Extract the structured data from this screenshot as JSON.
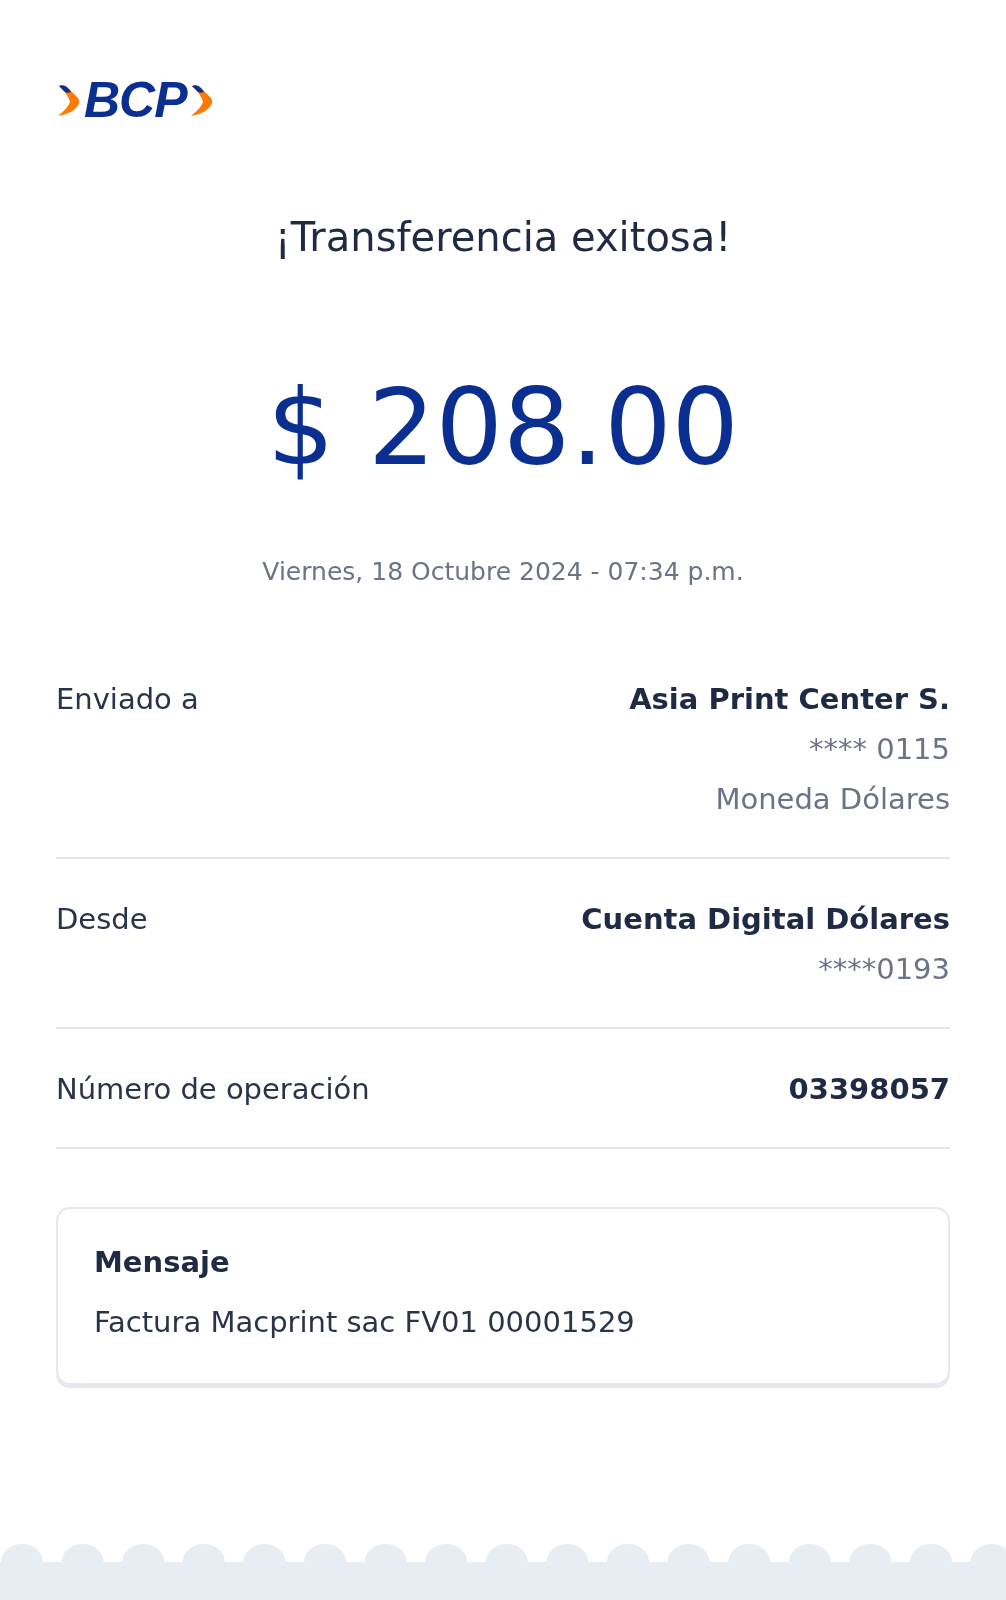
{
  "logo": {
    "text": "BCP"
  },
  "title": "¡Transferencia exitosa!",
  "amount": "$ 208.00",
  "date": "Viernes, 18 Octubre 2024 - 07:34 p.m.",
  "details": [
    {
      "label": "Enviado a",
      "lines": [
        "Asia Print Center S.",
        "**** 0115",
        "Moneda Dólares"
      ]
    },
    {
      "label": "Desde",
      "lines": [
        "Cuenta Digital Dólares",
        "****0193"
      ]
    },
    {
      "label": "Número de operación",
      "lines": [
        "03398057"
      ]
    }
  ],
  "message": {
    "title": "Mensaje",
    "text": "Factura Macprint sac FV01 00001529"
  }
}
